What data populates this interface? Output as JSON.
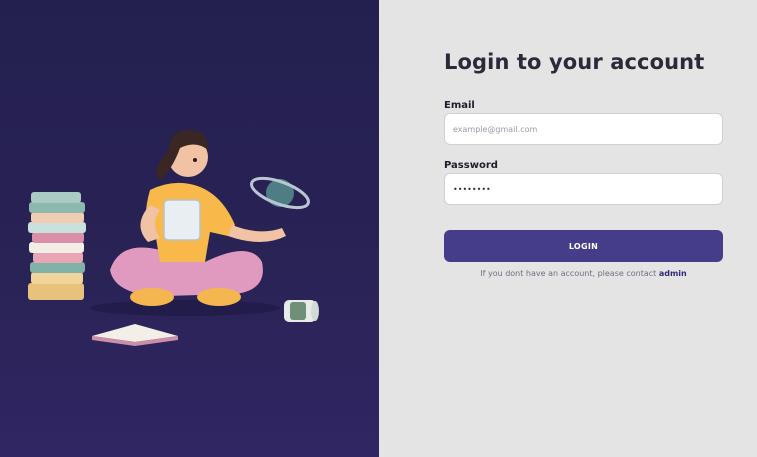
{
  "login": {
    "title": "Login to your account",
    "email_label": "Email",
    "email_placeholder": "example@gmail.com",
    "password_label": "Password",
    "password_value": "********",
    "button_label": "LOGIN",
    "contact_text": "If you dont have an account, please contact",
    "contact_link": "admin"
  },
  "colors": {
    "left_panel_bg": "#262150",
    "right_panel_bg": "#e4e4e4",
    "button_bg": "#463d8a",
    "link": "#2f2a7a"
  },
  "illustration": {
    "icons": [
      "book-stack-icon",
      "person-with-tablet-icon",
      "planet-icon",
      "coffee-cup-icon",
      "open-book-icon"
    ]
  }
}
